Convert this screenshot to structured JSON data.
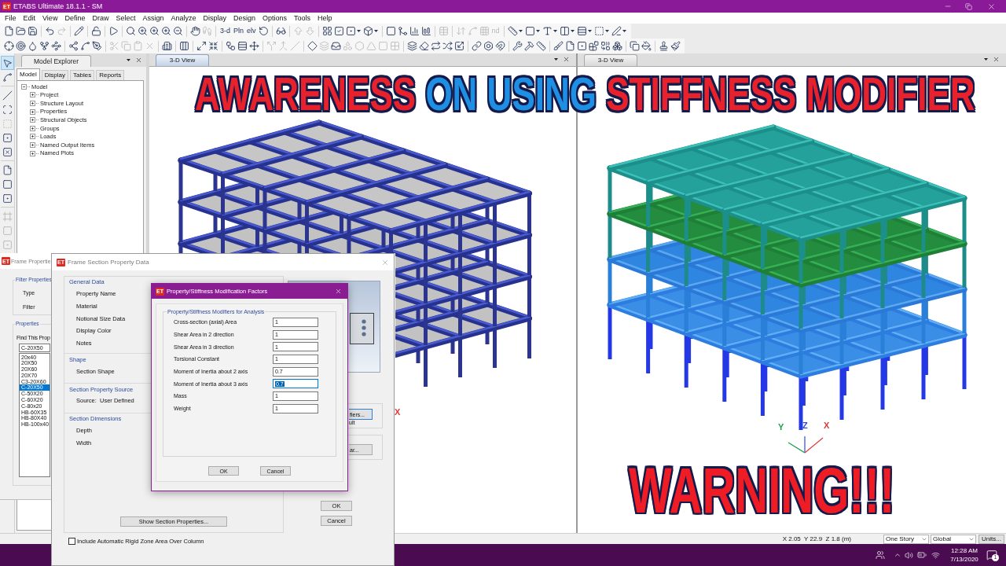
{
  "window": {
    "logo": "ET",
    "title": "ETABS Ultimate 18.1.1 - SM"
  },
  "menu": [
    "File",
    "Edit",
    "View",
    "Define",
    "Draw",
    "Select",
    "Assign",
    "Analyze",
    "Display",
    "Design",
    "Options",
    "Tools",
    "Help"
  ],
  "toolbar_rows": [
    {
      "items": [
        {
          "kind": "icon",
          "disabled": false
        },
        {
          "kind": "icon",
          "disabled": false
        },
        {
          "kind": "icon",
          "disabled": false
        },
        {
          "kind": "separator"
        },
        {
          "kind": "icon",
          "disabled": false
        },
        {
          "kind": "icon",
          "disabled": true
        },
        {
          "kind": "separator"
        },
        {
          "kind": "icon",
          "disabled": false
        },
        {
          "kind": "separator"
        },
        {
          "kind": "icon",
          "disabled": false
        },
        {
          "kind": "separator"
        },
        {
          "kind": "icon",
          "disabled": false
        },
        {
          "kind": "separator"
        },
        {
          "kind": "icon",
          "disabled": false
        },
        {
          "kind": "icon",
          "disabled": false
        },
        {
          "kind": "icon",
          "disabled": false
        },
        {
          "kind": "icon",
          "disabled": false
        },
        {
          "kind": "icon",
          "disabled": false
        },
        {
          "kind": "separator"
        },
        {
          "kind": "icon",
          "disabled": false
        },
        {
          "kind": "icon",
          "disabled": true
        },
        {
          "kind": "separator"
        },
        {
          "kind": "text",
          "label": "3-d",
          "disabled": false
        },
        {
          "kind": "text",
          "label": "Pln",
          "disabled": false
        },
        {
          "kind": "text",
          "label": "elv",
          "disabled": false
        },
        {
          "kind": "icon",
          "disabled": false
        },
        {
          "kind": "separator"
        },
        {
          "kind": "icon",
          "disabled": false
        },
        {
          "kind": "separator"
        },
        {
          "kind": "icon",
          "disabled": true
        },
        {
          "kind": "icon",
          "disabled": true
        },
        {
          "kind": "separator"
        },
        {
          "kind": "icon",
          "disabled": false
        },
        {
          "kind": "icon",
          "disabled": false
        },
        {
          "kind": "menu_icon",
          "disabled": false
        },
        {
          "kind": "menu_icon",
          "disabled": false
        },
        {
          "kind": "separator"
        },
        {
          "kind": "icon",
          "disabled": false
        },
        {
          "kind": "icon",
          "disabled": false
        },
        {
          "kind": "icon",
          "disabled": false
        },
        {
          "kind": "icon",
          "disabled": false
        },
        {
          "kind": "separator"
        },
        {
          "kind": "icon",
          "disabled": true
        },
        {
          "kind": "separator"
        },
        {
          "kind": "icon",
          "disabled": true
        },
        {
          "kind": "icon",
          "disabled": true
        },
        {
          "kind": "icon",
          "disabled": true
        },
        {
          "kind": "text",
          "label": "nd",
          "disabled": true
        },
        {
          "kind": "separator"
        },
        {
          "kind": "menu_icon",
          "disabled": false
        },
        {
          "kind": "menu_icon",
          "disabled": false
        },
        {
          "kind": "menu_icon",
          "disabled": false
        },
        {
          "kind": "menu_icon",
          "disabled": false
        },
        {
          "kind": "menu_icon",
          "disabled": false
        },
        {
          "kind": "menu_icon",
          "disabled": false
        },
        {
          "kind": "menu_icon",
          "disabled": false
        }
      ]
    },
    {
      "items": [
        {
          "kind": "icon",
          "disabled": false
        },
        {
          "kind": "icon",
          "disabled": false
        },
        {
          "kind": "icon",
          "disabled": false
        },
        {
          "kind": "icon",
          "disabled": false
        },
        {
          "kind": "icon",
          "disabled": false
        },
        {
          "kind": "separator"
        },
        {
          "kind": "icon",
          "disabled": false
        },
        {
          "kind": "icon",
          "disabled": false
        },
        {
          "kind": "icon",
          "disabled": false
        },
        {
          "kind": "separator"
        },
        {
          "kind": "icon",
          "disabled": true
        },
        {
          "kind": "icon",
          "disabled": true
        },
        {
          "kind": "icon",
          "disabled": true
        },
        {
          "kind": "icon",
          "disabled": true
        },
        {
          "kind": "separator"
        },
        {
          "kind": "icon",
          "disabled": false
        },
        {
          "kind": "separator"
        },
        {
          "kind": "icon",
          "disabled": false
        },
        {
          "kind": "separator"
        },
        {
          "kind": "icon",
          "disabled": false
        },
        {
          "kind": "icon",
          "disabled": false
        },
        {
          "kind": "separator"
        },
        {
          "kind": "icon",
          "disabled": false
        },
        {
          "kind": "icon",
          "disabled": false
        },
        {
          "kind": "icon",
          "disabled": false
        },
        {
          "kind": "separator"
        },
        {
          "kind": "icon",
          "disabled": true
        },
        {
          "kind": "icon",
          "disabled": true
        },
        {
          "kind": "icon",
          "disabled": true
        },
        {
          "kind": "separator"
        },
        {
          "kind": "icon",
          "disabled": false
        },
        {
          "kind": "icon",
          "disabled": true
        },
        {
          "kind": "icon",
          "disabled": false
        },
        {
          "kind": "icon",
          "disabled": true
        },
        {
          "kind": "icon",
          "disabled": true
        },
        {
          "kind": "icon",
          "disabled": true
        },
        {
          "kind": "icon",
          "disabled": true
        },
        {
          "kind": "icon",
          "disabled": true
        },
        {
          "kind": "separator"
        },
        {
          "kind": "icon",
          "disabled": false
        },
        {
          "kind": "icon",
          "disabled": false
        },
        {
          "kind": "icon",
          "disabled": false
        },
        {
          "kind": "icon",
          "disabled": false
        },
        {
          "kind": "icon",
          "disabled": false
        },
        {
          "kind": "separator"
        },
        {
          "kind": "icon",
          "disabled": false
        },
        {
          "kind": "icon",
          "disabled": false
        },
        {
          "kind": "icon",
          "disabled": false
        },
        {
          "kind": "separator"
        },
        {
          "kind": "icon",
          "disabled": false
        },
        {
          "kind": "icon",
          "disabled": false
        },
        {
          "kind": "icon",
          "disabled": false
        },
        {
          "kind": "separator"
        },
        {
          "kind": "icon",
          "disabled": false
        },
        {
          "kind": "icon",
          "disabled": false
        },
        {
          "kind": "icon",
          "disabled": false
        },
        {
          "kind": "icon",
          "disabled": false
        },
        {
          "kind": "icon",
          "disabled": false
        },
        {
          "kind": "icon",
          "disabled": false
        },
        {
          "kind": "separator"
        },
        {
          "kind": "icon",
          "disabled": false
        },
        {
          "kind": "icon",
          "disabled": false
        },
        {
          "kind": "separator"
        },
        {
          "kind": "icon",
          "disabled": false
        },
        {
          "kind": "icon",
          "disabled": false
        }
      ]
    }
  ],
  "draw_tools": [
    {
      "tools": [
        {
          "selected": true,
          "disabled": false
        },
        {
          "selected": false,
          "disabled": false
        }
      ]
    },
    {
      "tools": [
        {
          "selected": false,
          "disabled": false
        },
        {
          "selected": false,
          "disabled": false
        },
        {
          "selected": false,
          "disabled": true
        },
        {
          "selected": false,
          "disabled": false
        },
        {
          "selected": false,
          "disabled": false
        }
      ]
    },
    {
      "tools": [
        {
          "selected": false,
          "disabled": false
        },
        {
          "selected": false,
          "disabled": false
        },
        {
          "selected": false,
          "disabled": false
        }
      ]
    },
    {
      "tools": [
        {
          "selected": false,
          "disabled": true
        },
        {
          "selected": false,
          "disabled": true
        },
        {
          "selected": false,
          "disabled": true
        }
      ]
    }
  ],
  "model_explorer": {
    "title": "Model Explorer",
    "tabs": [
      {
        "label": "Model",
        "selected": true
      },
      {
        "label": "Display",
        "selected": false
      },
      {
        "label": "Tables",
        "selected": false
      },
      {
        "label": "Reports",
        "selected": false
      }
    ],
    "tree": [
      {
        "label": "Model",
        "expanded": true,
        "children": [
          {
            "label": "Project",
            "expanded": false
          },
          {
            "label": "Structure Layout",
            "expanded": false
          },
          {
            "label": "Properties",
            "expanded": false
          },
          {
            "label": "Structural Objects",
            "expanded": false
          },
          {
            "label": "Groups",
            "expanded": false
          },
          {
            "label": "Loads",
            "expanded": false
          },
          {
            "label": "Named Output Items",
            "expanded": false
          },
          {
            "label": "Named Plots",
            "expanded": false
          }
        ]
      }
    ]
  },
  "views": [
    {
      "tab": "3-D View",
      "active": true,
      "axis_labels": [
        {
          "text": "X",
          "color": "#e03a3a"
        }
      ]
    },
    {
      "tab": "3-D View",
      "active": false,
      "axis_labels": [
        {
          "text": "Y",
          "color": "#1a9f4a"
        },
        {
          "text": "Z",
          "color": "#2a4ae0"
        },
        {
          "text": "X",
          "color": "#e03a3a"
        }
      ]
    }
  ],
  "headline": [
    {
      "text": "AWARENESS",
      "color": "#e8222c"
    },
    {
      "text": "ON USING",
      "color": "#1f8fe3"
    },
    {
      "text": "STIFFNESS MODIFIER",
      "color": "#e8222c"
    }
  ],
  "warning": "WARNING!!!",
  "frame_properties": {
    "logo": "ET",
    "title": "Frame Propertie",
    "filter_group": "Filter Properties",
    "type_label": "Type",
    "filter_label": "Filter",
    "properties_group": "Properties",
    "find_label": "Find This Prop",
    "find_value": "C-20X50",
    "items": [
      {
        "label": "20x40",
        "selected": false
      },
      {
        "label": "20X50",
        "selected": false
      },
      {
        "label": "20X60",
        "selected": false
      },
      {
        "label": "20X70",
        "selected": false
      },
      {
        "label": "C3-20X60",
        "selected": false
      },
      {
        "label": "C-20X50",
        "selected": true
      },
      {
        "label": "C-50X20",
        "selected": false
      },
      {
        "label": "C-60X20",
        "selected": false
      },
      {
        "label": "C-80x20",
        "selected": false
      },
      {
        "label": "HB-60X35",
        "selected": false
      },
      {
        "label": "HB-80X40",
        "selected": false
      },
      {
        "label": "HB-100x40",
        "selected": false
      }
    ]
  },
  "frame_section": {
    "logo": "ET",
    "title": "Frame Section Property Data",
    "sections": [
      {
        "title": "General Data",
        "fields": [
          "Property Name",
          "Material",
          "Notional Size Data",
          "Display Color",
          "Notes"
        ]
      },
      {
        "title": "Shape",
        "fields": [
          "Section Shape"
        ]
      },
      {
        "title": "Section Property Source",
        "fields": [
          "Source:  User Defined"
        ]
      },
      {
        "title": "Section Dimensions",
        "fields": [
          "Depth",
          "Width"
        ]
      }
    ],
    "side_items": [
      {
        "kind": "button",
        "label": "fiers...",
        "focused": true
      },
      {
        "kind": "text",
        "label": "ult"
      },
      {
        "kind": "button",
        "label": "ar...",
        "focused": false
      }
    ],
    "show_properties_button": "Show Section Properties...",
    "ok_button": "OK",
    "cancel_button": "Cancel",
    "rigid_zone": {
      "label": "Include Automatic Rigid Zone Area Over Column",
      "checked": false
    }
  },
  "modifiers_dialog": {
    "logo": "ET",
    "title": "Property/Stiffness Modification Factors",
    "group": "Property/Stiffness Modifiers for Analysis",
    "rows": [
      {
        "label": "Cross-section (axial) Area",
        "value": "1",
        "focused": false
      },
      {
        "label": "Shear Area in 2 direction",
        "value": "1",
        "focused": false
      },
      {
        "label": "Shear Area in 3 direction",
        "value": "1",
        "focused": false
      },
      {
        "label": "Torsional Constant",
        "value": "1",
        "focused": false
      },
      {
        "label": "Moment of Inertia about 2 axis",
        "value": "0.7",
        "focused": false
      },
      {
        "label": "Moment of Inertia about 3 axis",
        "value": "0.7",
        "focused": true
      },
      {
        "label": "Mass",
        "value": "1",
        "focused": false
      },
      {
        "label": "Weight",
        "value": "1",
        "focused": false
      }
    ],
    "ok_button": "OK",
    "cancel_button": "Cancel"
  },
  "status_bar": {
    "coordinates": "X 2.05  Y 22.9  Z 1.8 (m)",
    "story": "One Story",
    "coordinate_system": "Global",
    "units_button": "Units..."
  },
  "taskbar": {
    "time": "12:28 AM",
    "date": "7/13/2020",
    "notification_count": "1"
  }
}
